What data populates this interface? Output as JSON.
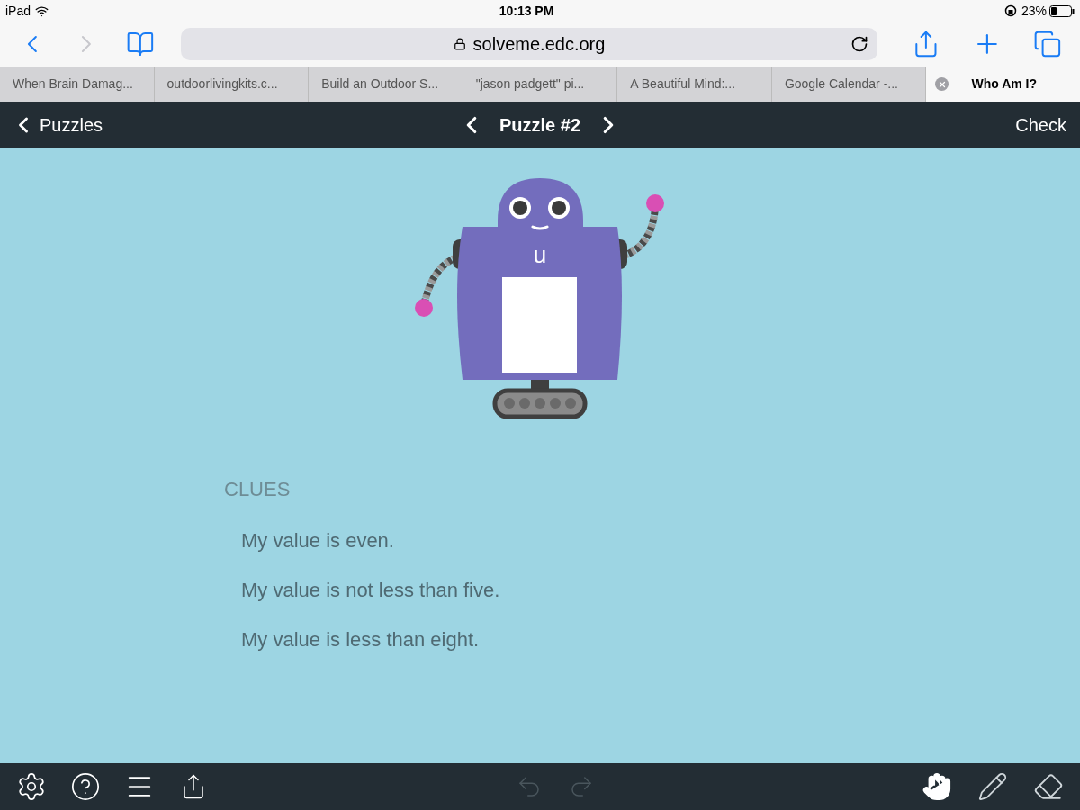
{
  "status_bar": {
    "device": "iPad",
    "time": "10:13 PM",
    "battery": "23%"
  },
  "browser": {
    "url": "solveme.edc.org",
    "tabs": [
      {
        "label": "When Brain Damag...",
        "selected": false
      },
      {
        "label": "outdoorlivingkits.c...",
        "selected": false
      },
      {
        "label": "Build an Outdoor S...",
        "selected": false
      },
      {
        "label": "\"jason padgett\" pi...",
        "selected": false
      },
      {
        "label": "A Beautiful Mind:...",
        "selected": false
      },
      {
        "label": "Google Calendar -...",
        "selected": false
      },
      {
        "label": "Who Am I?",
        "selected": true
      }
    ]
  },
  "app_bar": {
    "back": "Puzzles",
    "title": "Puzzle #2",
    "action": "Check"
  },
  "robot": {
    "label": "u"
  },
  "clues": {
    "heading": "CLUES",
    "items": [
      "My value is even.",
      "My value is not less than five.",
      "My value is less than eight."
    ]
  },
  "toolbar": {
    "tools": [
      {
        "kind": "hand",
        "selected": true
      },
      {
        "kind": "pencil",
        "selected": false
      },
      {
        "kind": "eraser",
        "selected": false
      }
    ]
  }
}
